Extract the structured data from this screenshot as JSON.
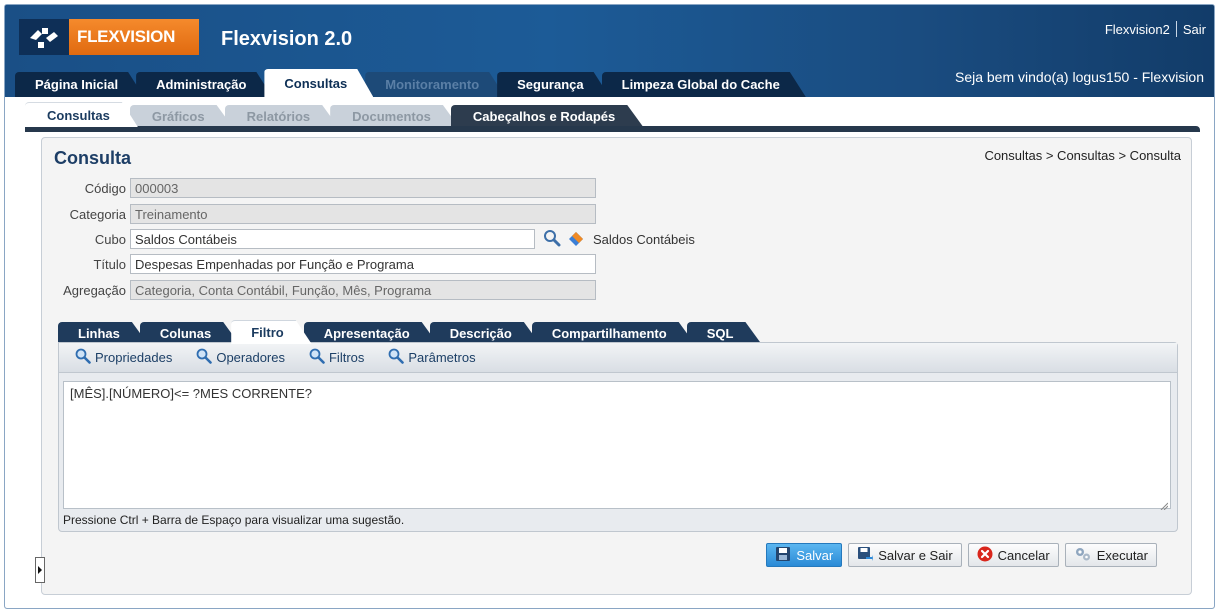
{
  "header": {
    "logo_text": "FLEXVISION",
    "app_title": "Flexvision 2.0",
    "user_link": "Flexvision2",
    "logout_link": "Sair",
    "welcome": "Seja bem vindo(a) logus150 - Flexvision"
  },
  "main_tabs": [
    {
      "label": "Página Inicial",
      "state": "normal"
    },
    {
      "label": "Administração",
      "state": "normal"
    },
    {
      "label": "Consultas",
      "state": "active"
    },
    {
      "label": "Monitoramento",
      "state": "disabled"
    },
    {
      "label": "Segurança",
      "state": "normal"
    },
    {
      "label": "Limpeza Global do Cache",
      "state": "normal"
    }
  ],
  "sub_tabs": [
    {
      "label": "Consultas",
      "state": "active"
    },
    {
      "label": "Gráficos",
      "state": "normal"
    },
    {
      "label": "Relatórios",
      "state": "normal"
    },
    {
      "label": "Documentos",
      "state": "normal"
    },
    {
      "label": "Cabeçalhos e Rodapés",
      "state": "dark"
    }
  ],
  "panel": {
    "title": "Consulta",
    "breadcrumb": "Consultas > Consultas > Consulta"
  },
  "form": {
    "codigo": {
      "label": "Código",
      "value": "000003"
    },
    "categoria": {
      "label": "Categoria",
      "value": "Treinamento"
    },
    "cubo": {
      "label": "Cubo",
      "value": "Saldos Contábeis",
      "description": "Saldos Contábeis"
    },
    "titulo": {
      "label": "Título",
      "value": "Despesas Empenhadas por Função e Programa"
    },
    "agregacao": {
      "label": "Agregação",
      "value": "Categoria, Conta Contábil, Função, Mês, Programa"
    }
  },
  "inner_tabs": [
    {
      "label": "Linhas",
      "state": "normal"
    },
    {
      "label": "Colunas",
      "state": "normal"
    },
    {
      "label": "Filtro",
      "state": "active"
    },
    {
      "label": "Apresentação",
      "state": "normal"
    },
    {
      "label": "Descrição",
      "state": "normal"
    },
    {
      "label": "Compartilhamento",
      "state": "normal"
    },
    {
      "label": "SQL",
      "state": "normal"
    }
  ],
  "toolbar": {
    "propriedades": "Propriedades",
    "operadores": "Operadores",
    "filtros": "Filtros",
    "parametros": "Parâmetros"
  },
  "editor": {
    "text": "[MÊS].[NÚMERO]<= ?MES CORRENTE?",
    "hint": "Pressione Ctrl + Barra de Espaço para visualizar uma sugestão."
  },
  "actions": {
    "save": "Salvar",
    "save_exit": "Salvar e Sair",
    "cancel": "Cancelar",
    "execute": "Executar"
  },
  "colors": {
    "header_blue": "#1c5b97",
    "logo_orange": "#f58a2c",
    "tab_dark": "#1f3b5c",
    "primary_button": "#2a8ad6",
    "cancel_red": "#d9261c"
  }
}
